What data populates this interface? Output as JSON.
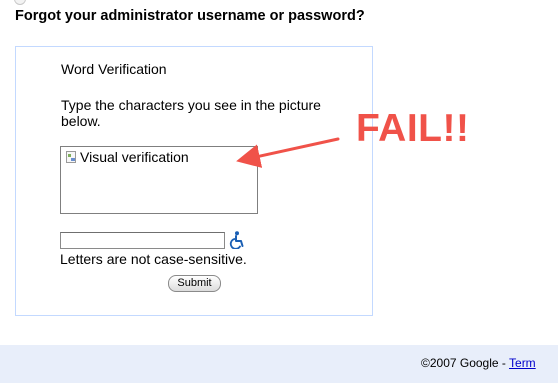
{
  "page": {
    "title": "Forgot your administrator username or password?"
  },
  "verification": {
    "heading": "Word Verification",
    "instruction": "Type the characters you see in the picture below.",
    "captcha_alt": "Visual verification",
    "input_value": "",
    "case_note": "Letters are not case-sensitive.",
    "submit_label": "Submit"
  },
  "annotation": {
    "text": "FAIL!!",
    "color": "#f05249"
  },
  "footer": {
    "copyright": "©2007 Google - ",
    "link_label": "Term"
  },
  "icons": {
    "broken_image": "broken-image-icon",
    "accessibility": "wheelchair-accessibility-icon"
  }
}
